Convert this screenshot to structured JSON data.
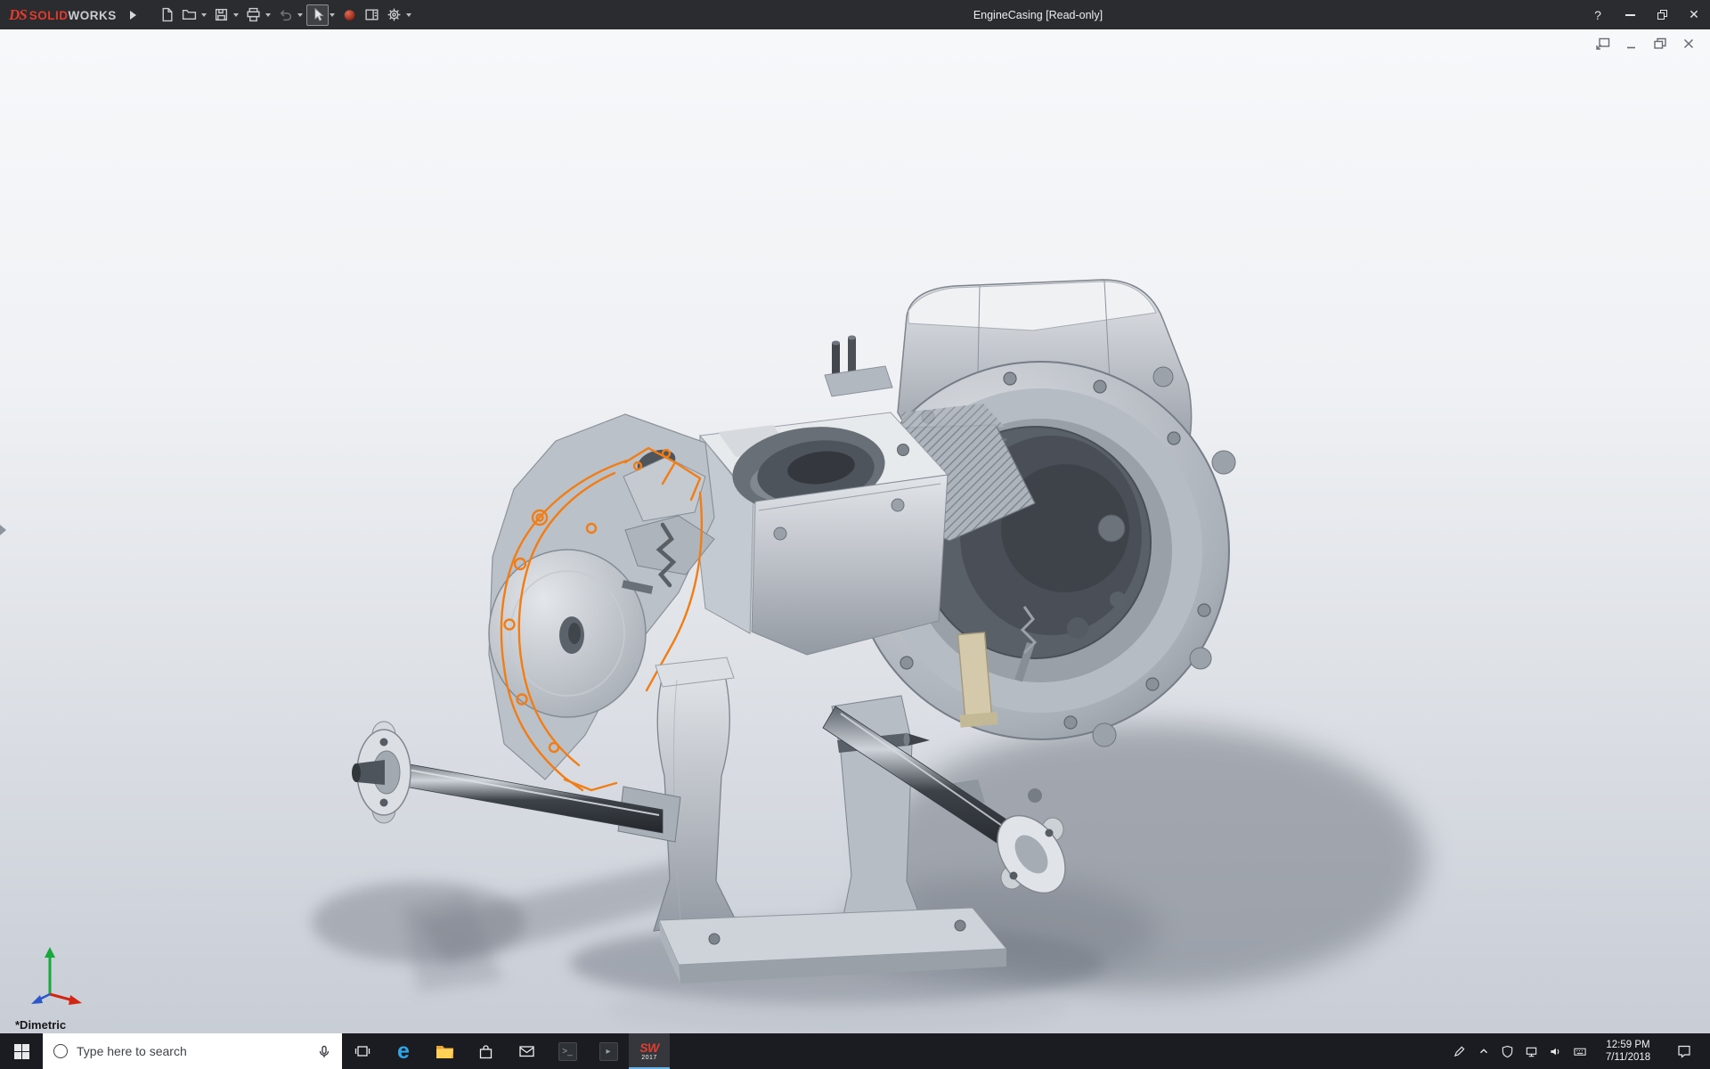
{
  "titlebar": {
    "logo_ds": "DS",
    "logo_solid": "SOLID",
    "logo_works": "WORKS",
    "document_title": "EngineCasing [Read-only]",
    "help_glyph": "?",
    "close_glyph": "✕",
    "toolbar_icon_names": [
      "flyout-expand-icon",
      "new-document-icon",
      "open-icon",
      "save-icon",
      "print-icon",
      "undo-icon",
      "select-cursor-icon",
      "file-properties-icon",
      "display-pane-icon",
      "options-gear-icon"
    ]
  },
  "document_window": {
    "control_icon_names": [
      "float-window-icon",
      "minimize-icon",
      "restore-icon",
      "close-icon"
    ]
  },
  "viewport": {
    "view_orientation_label": "*Dimetric",
    "selection_color": "#f17d17",
    "background_top": "#f7f8fa",
    "background_bottom": "#c8cdd6"
  },
  "taskbar": {
    "search_placeholder": "Type here to search",
    "edge_glyph": "e",
    "solidworks_logo": "SW",
    "solidworks_year": "2017",
    "clock_time": "12:59 PM",
    "clock_date": "7/11/2018",
    "tray_icon_names": [
      "pen-icon",
      "hidden-icons-chevron-icon",
      "defender-shield-icon",
      "network-icon",
      "volume-icon",
      "keyboard-icon",
      "action-center-icon"
    ]
  },
  "colors": {
    "titlebar_bg": "#2b2c2f",
    "taskbar_bg": "#1b1c21",
    "solidworks_red": "#e03e2d",
    "edge_blue": "#2ea7ea",
    "folder_yellow": "#ffd157"
  }
}
